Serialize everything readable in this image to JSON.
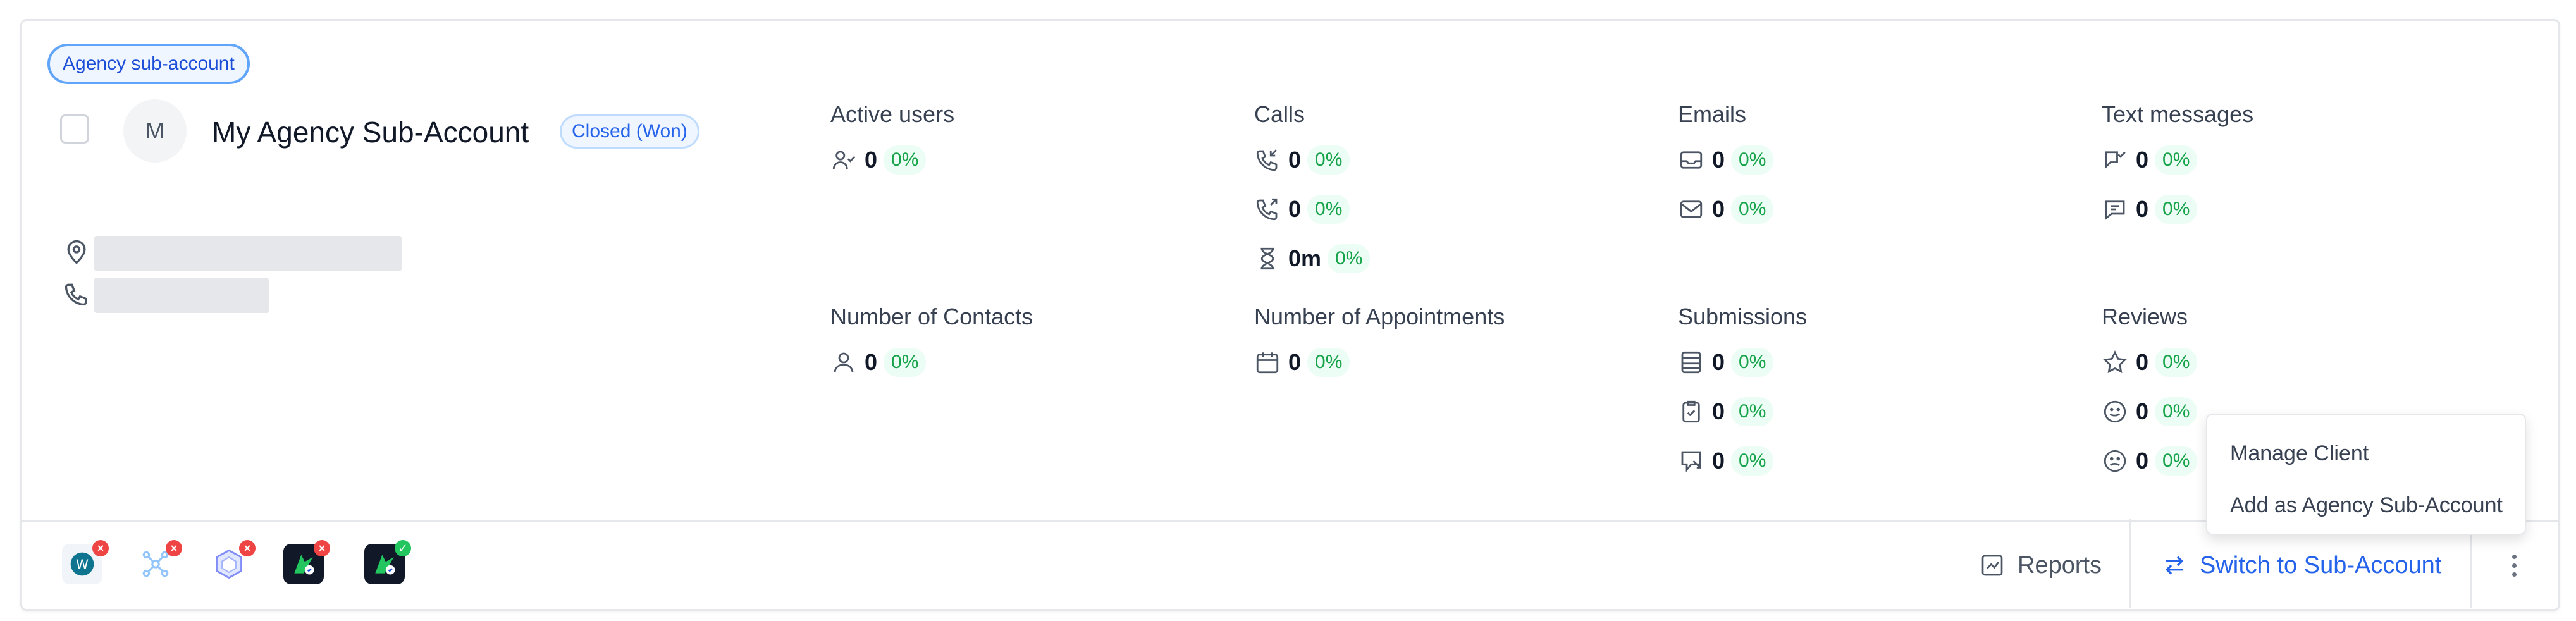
{
  "account": {
    "badge": "Agency sub-account",
    "avatar_initial": "M",
    "name": "My Agency Sub-Account",
    "status": "Closed (Won)"
  },
  "metrics": {
    "active_users": {
      "title": "Active users",
      "rows": [
        {
          "icon": "user-check-icon",
          "value": "0",
          "pct": "0%"
        }
      ]
    },
    "calls": {
      "title": "Calls",
      "rows": [
        {
          "icon": "phone-incoming-icon",
          "value": "0",
          "pct": "0%"
        },
        {
          "icon": "phone-outgoing-icon",
          "value": "0",
          "pct": "0%"
        },
        {
          "icon": "hourglass-icon",
          "value": "0m",
          "pct": "0%"
        }
      ]
    },
    "emails": {
      "title": "Emails",
      "rows": [
        {
          "icon": "inbox-icon",
          "value": "0",
          "pct": "0%"
        },
        {
          "icon": "mail-icon",
          "value": "0",
          "pct": "0%"
        }
      ]
    },
    "text_messages": {
      "title": "Text messages",
      "rows": [
        {
          "icon": "message-check-icon",
          "value": "0",
          "pct": "0%"
        },
        {
          "icon": "message-icon",
          "value": "0",
          "pct": "0%"
        }
      ]
    },
    "contacts": {
      "title": "Number of Contacts",
      "rows": [
        {
          "icon": "user-icon",
          "value": "0",
          "pct": "0%"
        }
      ]
    },
    "appointments": {
      "title": "Number of Appointments",
      "rows": [
        {
          "icon": "calendar-icon",
          "value": "0",
          "pct": "0%"
        }
      ]
    },
    "submissions": {
      "title": "Submissions",
      "rows": [
        {
          "icon": "form-icon",
          "value": "0",
          "pct": "0%"
        },
        {
          "icon": "clipboard-check-icon",
          "value": "0",
          "pct": "0%"
        },
        {
          "icon": "survey-icon",
          "value": "0",
          "pct": "0%"
        }
      ]
    },
    "reviews": {
      "title": "Reviews",
      "rows": [
        {
          "icon": "star-icon",
          "value": "0",
          "pct": "0%"
        },
        {
          "icon": "smile-icon",
          "value": "0",
          "pct": "0%"
        },
        {
          "icon": "frown-icon",
          "value": "0",
          "pct": "0%"
        }
      ]
    }
  },
  "footer": {
    "integrations": [
      {
        "icon": "wordpress-icon",
        "status": "error"
      },
      {
        "icon": "network-icon",
        "status": "error"
      },
      {
        "icon": "hexagon-app-icon",
        "status": "error"
      },
      {
        "icon": "phone-app-icon",
        "status": "error"
      },
      {
        "icon": "phone-app-icon",
        "status": "connected"
      }
    ],
    "reports_label": "Reports",
    "switch_label": "Switch to Sub-Account"
  },
  "dropdown": {
    "items": [
      "Manage Client",
      "Add as Agency Sub-Account"
    ]
  },
  "colors": {
    "accent": "#2563eb",
    "success": "#16a34a",
    "error": "#ef4444"
  }
}
